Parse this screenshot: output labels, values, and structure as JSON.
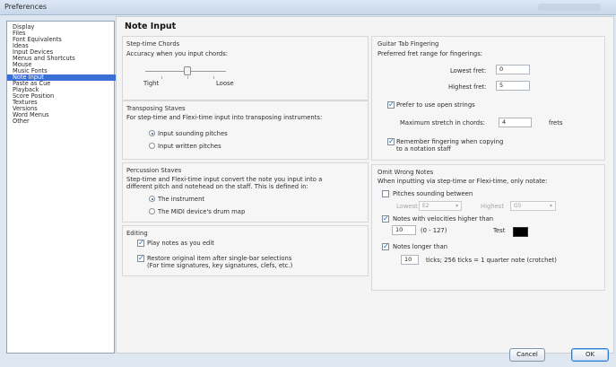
{
  "window": {
    "title": "Preferences"
  },
  "sidebar": {
    "items": [
      "Display",
      "Files",
      "Font Equivalents",
      "Ideas",
      "Input Devices",
      "Menus and Shortcuts",
      "Mouse",
      "Music Fonts",
      "Note Input",
      "Paste as Cue",
      "Playback",
      "Score Position",
      "Textures",
      "Versions",
      "Word Menus",
      "Other"
    ],
    "selected": "Note Input"
  },
  "page": {
    "title": "Note Input"
  },
  "step_time_chords": {
    "title": "Step-time Chords",
    "accuracy_label": "Accuracy when you input chords:",
    "tight_label": "Tight",
    "loose_label": "Loose"
  },
  "transposing_staves": {
    "title": "Transposing Staves",
    "description": "For step-time and Flexi-time input into transposing instruments:",
    "option_sounding": "Input sounding pitches",
    "option_written": "Input written pitches"
  },
  "percussion_staves": {
    "title": "Percussion Staves",
    "description_line1": "Step-time and Flexi-time input convert the note you input into a",
    "description_line2": "different pitch and notehead on the staff. This is defined in:",
    "option_instrument": "The instrument",
    "option_midi": "The MIDI device's drum map"
  },
  "editing": {
    "title": "Editing",
    "play_notes_label": "Play notes as you edit",
    "restore_line1": "Restore original item after single-bar selections",
    "restore_line2": "(For time signatures, key signatures, clefs, etc.)"
  },
  "guitar_tab": {
    "title": "Guitar Tab Fingering",
    "preferred_range_label": "Preferred fret range for fingerings:",
    "lowest_fret_label": "Lowest fret:",
    "lowest_fret_value": "0",
    "highest_fret_label": "Highest fret:",
    "highest_fret_value": "5",
    "prefer_open_label": "Prefer to use open strings",
    "max_stretch_label": "Maximum stretch in chords:",
    "max_stretch_value": "4",
    "frets_label": "frets",
    "remember_line1": "Remember fingering when copying",
    "remember_line2": "to a notation staff"
  },
  "omit_wrong_notes": {
    "title": "Omit Wrong Notes",
    "description": "When inputting via step-time or Flexi-time, only notate:",
    "pitches_between_label": "Pitches sounding between",
    "lowest_label": "Lowest",
    "lowest_value": "E2",
    "highest_label": "Highest",
    "highest_value": "G5",
    "velocities_label": "Notes with velocities higher than",
    "velocity_value": "10",
    "velocity_range": "(0 - 127)",
    "test_label": "Test",
    "longer_than_label": "Notes longer than",
    "ticks_value": "10",
    "ticks_desc": "ticks; 256 ticks = 1 quarter note (crotchet)"
  },
  "buttons": {
    "cancel": "Cancel",
    "ok": "OK"
  }
}
